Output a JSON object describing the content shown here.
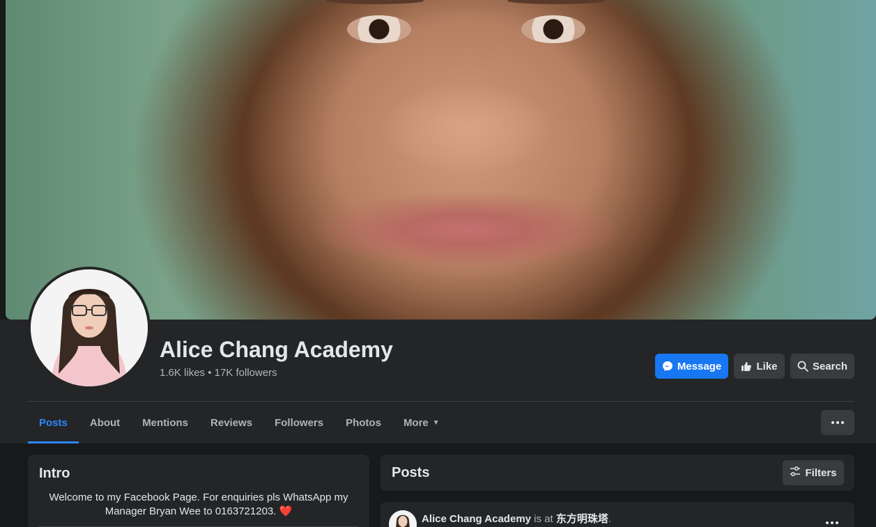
{
  "page": {
    "name": "Alice Chang Academy",
    "stats": "1.6K likes • 17K followers"
  },
  "actions": {
    "message_label": "Message",
    "like_label": "Like",
    "search_label": "Search"
  },
  "tabs": [
    {
      "label": "Posts",
      "active": true
    },
    {
      "label": "About"
    },
    {
      "label": "Mentions"
    },
    {
      "label": "Reviews"
    },
    {
      "label": "Followers"
    },
    {
      "label": "Photos"
    },
    {
      "label": "More"
    }
  ],
  "intro": {
    "title": "Intro",
    "text": "Welcome to my Facebook Page. For enquiries pls WhatsApp my Manager Bryan Wee to 0163721203.",
    "emoji": "❤️"
  },
  "posts": {
    "title": "Posts",
    "filters_label": "Filters"
  },
  "post": {
    "author": "Alice Chang Academy",
    "connector": " is at ",
    "place": "东方明珠塔",
    "suffix": "."
  },
  "colors": {
    "accent": "#1877f2",
    "active_tab": "#2d88ff",
    "surface": "#242526",
    "background": "#18191a"
  },
  "icons": [
    "messenger-icon",
    "thumbs-up-icon",
    "search-icon",
    "more-dots-icon",
    "filters-icon",
    "caret-down-icon"
  ]
}
